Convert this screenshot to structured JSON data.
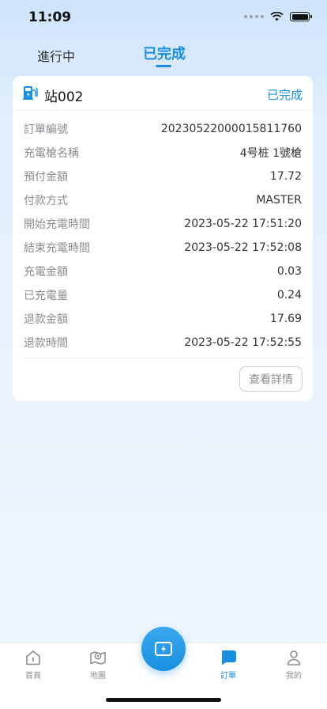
{
  "status_bar": {
    "time": "11:09"
  },
  "tabs": {
    "ongoing": "進行中",
    "completed": "已完成"
  },
  "order": {
    "station": "站002",
    "status": "已完成",
    "rows": [
      {
        "label": "訂單編號",
        "value": "20230522000015811760"
      },
      {
        "label": "充電槍名稱",
        "value": "4号桩 1號槍"
      },
      {
        "label": "預付金額",
        "value": "17.72"
      },
      {
        "label": "付款方式",
        "value": "MASTER"
      },
      {
        "label": "開始充電時間",
        "value": "2023-05-22 17:51:20"
      },
      {
        "label": "結束充電時間",
        "value": "2023-05-22 17:52:08"
      },
      {
        "label": "充電金額",
        "value": "0.03"
      },
      {
        "label": "已充電量",
        "value": "0.24"
      },
      {
        "label": "退款金額",
        "value": "17.69"
      },
      {
        "label": "退款時間",
        "value": "2023-05-22 17:52:55"
      }
    ],
    "detail_button": "查看詳情"
  },
  "tabbar": {
    "home": "首頁",
    "map": "地圖",
    "order": "訂單",
    "me": "我的"
  },
  "colors": {
    "accent": "#1a8fe0",
    "muted": "#8a8d91"
  }
}
